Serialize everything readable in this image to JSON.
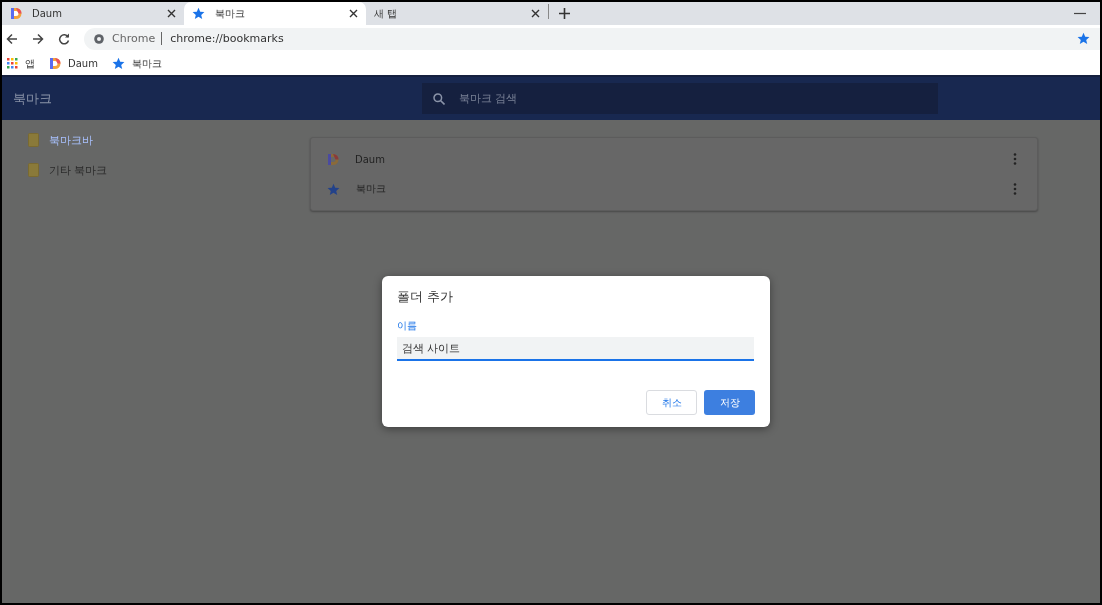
{
  "tabs": [
    {
      "kind": "daum",
      "title": "Daum",
      "selected": false
    },
    {
      "kind": "star",
      "title": "북마크",
      "selected": true
    },
    {
      "kind": "blank",
      "title": "새 탭",
      "selected": false
    }
  ],
  "address": {
    "site": "Chrome",
    "url": "chrome://bookmarks"
  },
  "bookmarks_bar": [
    {
      "kind": "apps",
      "label": "앱"
    },
    {
      "kind": "daum",
      "label": "Daum"
    },
    {
      "kind": "star",
      "label": "북마크"
    }
  ],
  "app_header": {
    "title": "북마크",
    "search_placeholder": "북마크 검색"
  },
  "sidebar": {
    "items": [
      {
        "label": "북마크바",
        "selected": true
      },
      {
        "label": "기타 북마크",
        "selected": false
      }
    ]
  },
  "list": {
    "items": [
      {
        "kind": "daum",
        "title": "Daum"
      },
      {
        "kind": "star",
        "title": "북마크"
      }
    ]
  },
  "dialog": {
    "title": "폴더 추가",
    "field_label": "이름",
    "value": "검색 사이트",
    "buttons": [
      {
        "kind": "secondary",
        "label": "취소"
      },
      {
        "kind": "primary",
        "label": "저장"
      }
    ]
  }
}
